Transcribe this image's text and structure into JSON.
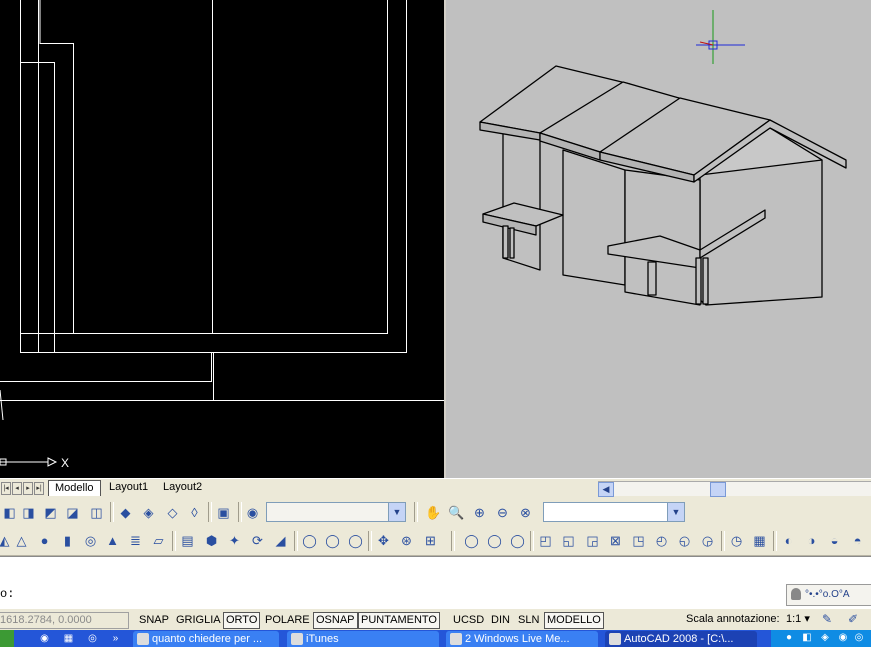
{
  "left_viewport": {
    "axis_label": "X"
  },
  "layout_tabs": [
    {
      "label": "Modello"
    },
    {
      "label": "Layout1"
    },
    {
      "label": "Layout2"
    }
  ],
  "command_line": {
    "prompt": "o:",
    "user_text": "°•.•°o.O°A"
  },
  "status_bar": {
    "coordinates": "1618.2784, 0.0000",
    "toggles": [
      {
        "label": "SNAP",
        "on": false
      },
      {
        "label": "GRIGLIA",
        "on": false
      },
      {
        "label": "ORTO",
        "on": true
      },
      {
        "label": "POLARE",
        "on": false
      },
      {
        "label": "OSNAP",
        "on": true
      },
      {
        "label": "PUNTAMENTO",
        "on": true
      },
      {
        "label": "UCSD",
        "on": false
      },
      {
        "label": "DIN",
        "on": false
      },
      {
        "label": "SLN",
        "on": false
      },
      {
        "label": "MODELLO",
        "on": true
      }
    ],
    "annotation_scale_label": "Scala annotazione:",
    "annotation_scale_value": "1:1 ▾"
  },
  "taskbar": {
    "buttons": [
      {
        "label": "quanto chiedere per ..."
      },
      {
        "label": "iTunes"
      },
      {
        "label": "2 Windows Live Me..."
      },
      {
        "label": "AutoCAD 2008 - [C:\\..."
      }
    ]
  },
  "colors": {
    "viewport_left_bg": "#000000",
    "viewport_right_bg": "#c0c0c0",
    "taskbar": "#2456d8"
  }
}
